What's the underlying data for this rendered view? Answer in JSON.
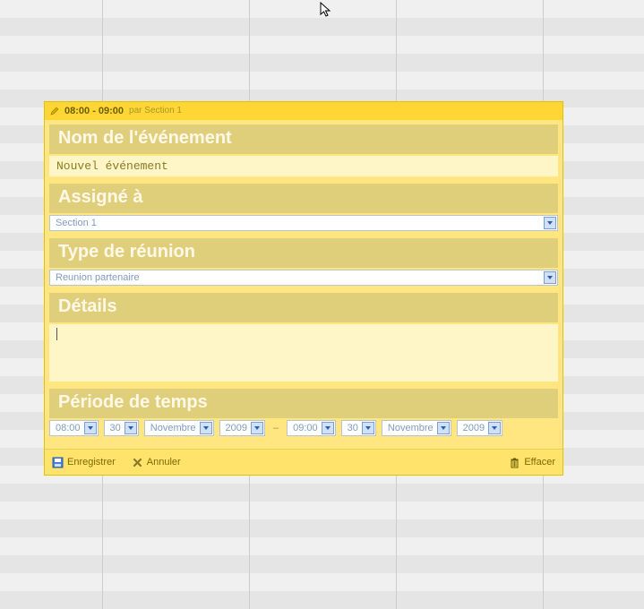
{
  "header": {
    "time_range": "08:00 - 09:00",
    "by_prefix": "par",
    "by_value": "Section 1"
  },
  "sections": {
    "name_label": "Nom de l'événement",
    "name_value": "Nouvel événement",
    "assigned_label": "Assigné à",
    "assigned_value": "Section 1",
    "type_label": "Type de réunion",
    "type_value": "Reunion partenaire",
    "details_label": "Détails",
    "details_value": "",
    "period_label": "Période de temps"
  },
  "period": {
    "start_hour": "08:00",
    "start_min": "30",
    "start_month": "Novembre",
    "start_year": "2009",
    "end_hour": "09:00",
    "end_min": "30",
    "end_month": "Novembre",
    "end_year": "2009"
  },
  "footer": {
    "save": "Enregistrer",
    "cancel": "Annuler",
    "clear": "Effacer"
  }
}
